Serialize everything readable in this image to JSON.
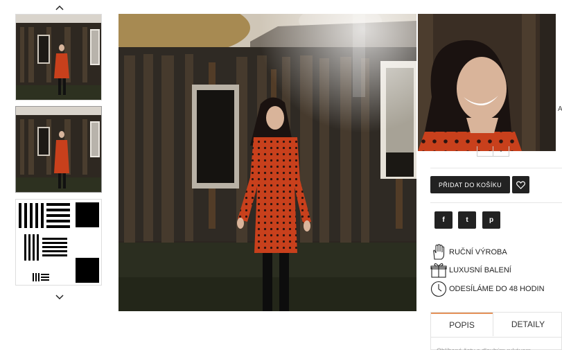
{
  "gallery": {
    "thumb_up_icon": "chevron-up-icon",
    "thumb_down_icon": "chevron-down-icon",
    "thumbnails": [
      "thumb-1",
      "thumb-2",
      "thumb-3"
    ]
  },
  "product": {
    "side_text": "AS",
    "add_to_cart_label": "PŘIDAT DO KOŠÍKU",
    "wishlist_icon": "heart-icon",
    "social": [
      {
        "icon": "facebook-icon",
        "glyph": "f"
      },
      {
        "icon": "twitter-icon",
        "glyph": "t"
      },
      {
        "icon": "pinterest-icon",
        "glyph": "p"
      }
    ],
    "features": [
      {
        "icon": "hand-icon",
        "label": "RUČNÍ VÝROBA"
      },
      {
        "icon": "gift-icon",
        "label": "LUXUSNÍ BALENÍ"
      },
      {
        "icon": "clock-icon",
        "label": "ODESÍLÁME DO 48 HODIN"
      }
    ],
    "tabs": [
      {
        "label": "POPIS",
        "active": true
      },
      {
        "label": "DETAILY",
        "active": false
      }
    ],
    "tab_body_preview": "Oblíbené šaty s dlouhým rukávem"
  },
  "colors": {
    "accent": "#e5925a",
    "button": "#222222",
    "dress": "#c8401c"
  }
}
